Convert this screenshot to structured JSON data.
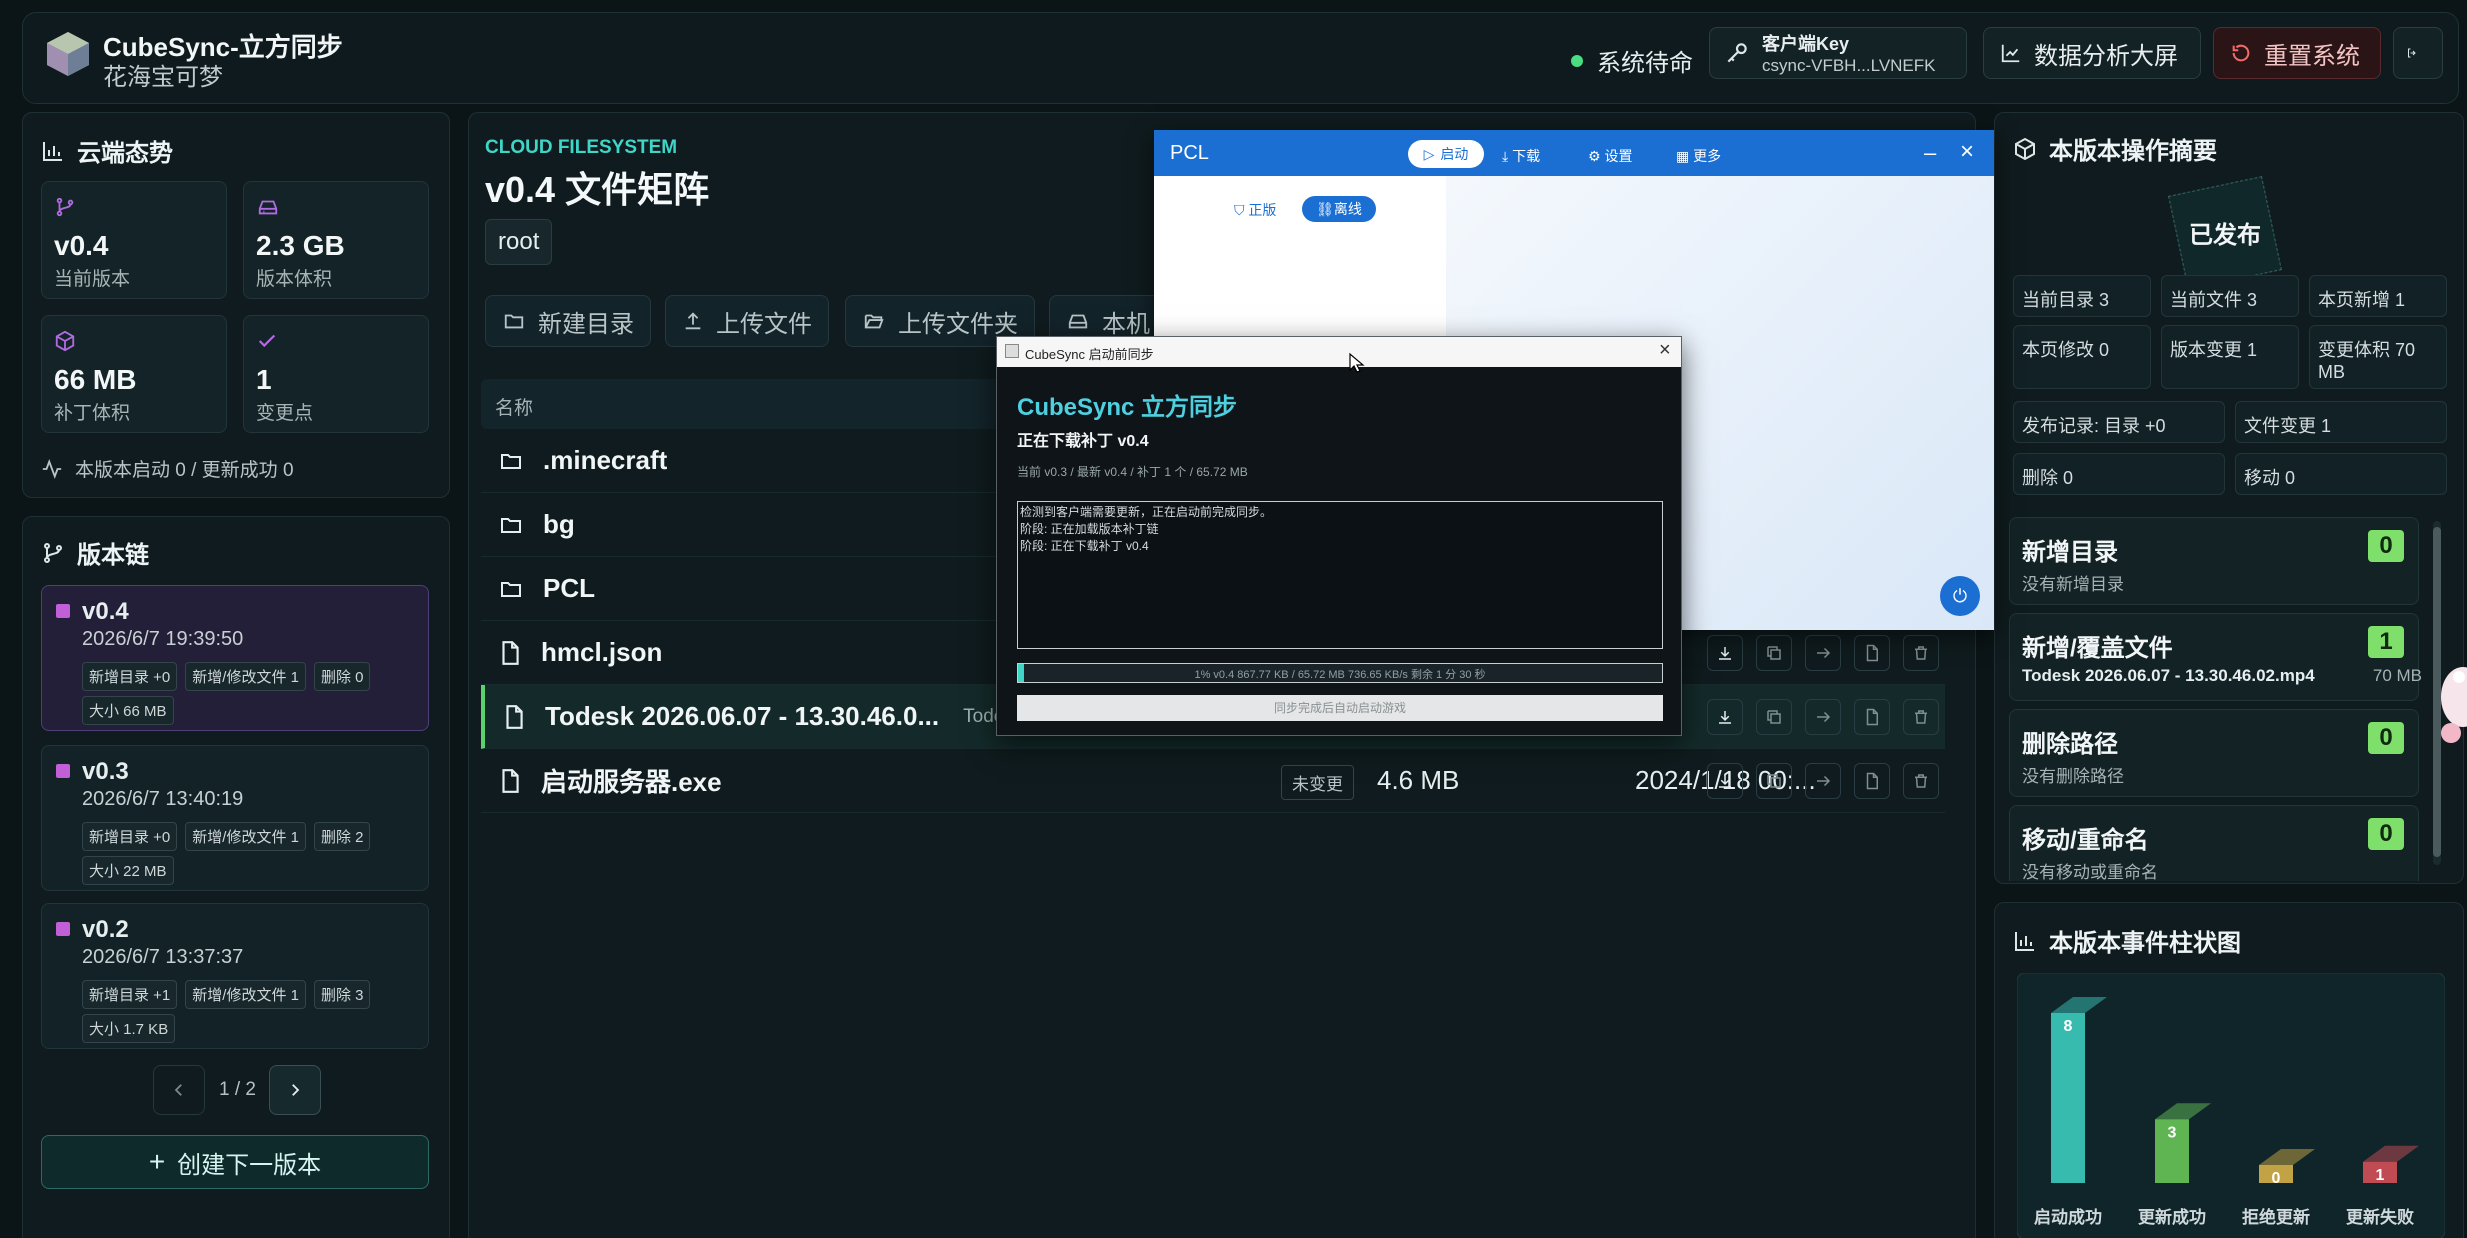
{
  "header": {
    "brand_title": "CubeSync-立方同步",
    "brand_sub": "花海宝可梦",
    "status": "系统待命",
    "key_label": "客户端Key",
    "key_value": "csync-VFBH...LVNEFK",
    "dashboard_btn": "数据分析大屏",
    "reset_btn": "重置系统",
    "colors": {
      "accent": "#3fd6c7",
      "danger": "#f26a6a",
      "status_dot": "#4ade80"
    }
  },
  "cloud": {
    "title": "云端态势",
    "stats": [
      {
        "value": "v0.4",
        "label": "当前版本",
        "icon": "branch-icon"
      },
      {
        "value": "2.3 GB",
        "label": "版本体积",
        "icon": "disk-icon"
      },
      {
        "value": "66 MB",
        "label": "补丁体积",
        "icon": "package-icon"
      },
      {
        "value": "1",
        "label": "变更点",
        "icon": "check-icon"
      }
    ],
    "footer": "本版本启动 0 / 更新成功 0"
  },
  "versions": {
    "title": "版本链",
    "items": [
      {
        "name": "v0.4",
        "date": "2026/6/7 19:39:50",
        "tags": [
          "新增目录 +0",
          "新增/修改文件 1",
          "删除 0"
        ],
        "size": "大小 66 MB"
      },
      {
        "name": "v0.3",
        "date": "2026/6/7 13:40:19",
        "tags": [
          "新增目录 +0",
          "新增/修改文件 1",
          "删除 2"
        ],
        "size": "大小 22 MB"
      },
      {
        "name": "v0.2",
        "date": "2026/6/7 13:37:37",
        "tags": [
          "新增目录 +1",
          "新增/修改文件 1",
          "删除 3"
        ],
        "size": "大小 1.7 KB"
      }
    ],
    "page": "1 / 2",
    "create_btn": "创建下一版本"
  },
  "files": {
    "kicker": "CLOUD FILESYSTEM",
    "title": "v0.4 文件矩阵",
    "path": "root",
    "toolbar": [
      "新建目录",
      "上传文件",
      "上传文件夹",
      "本机"
    ],
    "col_name": "名称",
    "rows": [
      {
        "name": ".minecraft",
        "type": "folder"
      },
      {
        "name": "bg",
        "type": "folder"
      },
      {
        "name": "PCL",
        "type": "folder"
      },
      {
        "name": "hmcl.json",
        "type": "file"
      },
      {
        "name": "Todesk 2026.06.07 - 13.30.46.0...",
        "type": "file",
        "extra": "Todesk"
      },
      {
        "name": "启动服务器.exe",
        "type": "file",
        "status": "未变更",
        "size": "4.6 MB",
        "date": "2024/1/18 00:..."
      }
    ]
  },
  "summary": {
    "title": "本版本操作摘要",
    "stamp": "已发布",
    "cells": [
      "当前目录 3",
      "当前文件 3",
      "本页新增 1",
      "本页修改 0",
      "版本变更 1",
      "变更体积 70 MB",
      "发布记录: 目录 +0",
      "文件变更 1",
      "删除 0",
      "移动 0"
    ],
    "sections": [
      {
        "title": "新增目录",
        "sub": "没有新增目录",
        "count": "0"
      },
      {
        "title": "新增/覆盖文件",
        "sub": "Todesk 2026.06.07 - 13.30.46.02.mp4",
        "sub2": "70 MB",
        "count": "1"
      },
      {
        "title": "删除路径",
        "sub": "没有删除路径",
        "count": "0"
      },
      {
        "title": "移动/重命名",
        "sub": "没有移动或重命名",
        "count": "0"
      }
    ]
  },
  "chart_data": {
    "type": "bar",
    "title": "本版本事件柱状图",
    "categories": [
      "启动成功",
      "更新成功",
      "拒绝更新",
      "更新失败"
    ],
    "values": [
      8,
      3,
      0,
      1
    ],
    "colors": [
      "#3fd6c7",
      "#6fcf5a",
      "#e0b84a",
      "#e0525a"
    ]
  },
  "pcl": {
    "title": "PCL",
    "tabs": [
      "启动",
      "下载",
      "设置",
      "更多"
    ],
    "sub_tabs": [
      "正版",
      "离线"
    ]
  },
  "sync_dialog": {
    "window_title": "CubeSync 启动前同步",
    "heading": "CubeSync 立方同步",
    "subheading": "正在下载补丁 v0.4",
    "meta": "当前 v0.3 / 最新 v0.4 / 补丁 1 个 / 65.72 MB",
    "log": [
      "检测到客户端需要更新，正在启动前完成同步。",
      "阶段: 正在加载版本补丁链",
      "阶段: 正在下载补丁 v0.4"
    ],
    "progress_text": "1%  v0.4  867.77 KB / 65.72 MB  736.65 KB/s  剩余 1 分 30 秒",
    "progress_fraction": 0.01,
    "hint": "同步完成后自动启动游戏"
  }
}
